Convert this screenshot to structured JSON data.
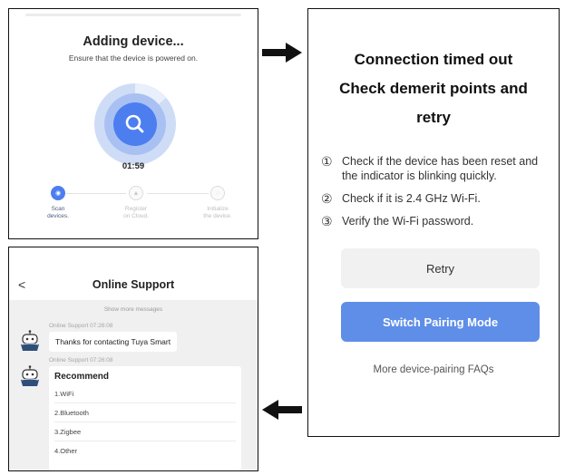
{
  "adding": {
    "title": "Adding device...",
    "subtitle": "Ensure that the device is powered on.",
    "timer": "01:59",
    "icon": "search-icon",
    "accent_color": "#4c7ef0",
    "steps": [
      {
        "label": "Scan\ndevices."
      },
      {
        "label": "Register\non Cloud."
      },
      {
        "label": "Initialize\nthe device."
      }
    ]
  },
  "timeout": {
    "title": "Connection timed out\nCheck demerit points and\nretry",
    "checks": [
      {
        "num": "①",
        "text": "Check if the device has been reset and the indicator is blinking quickly."
      },
      {
        "num": "②",
        "text": "Check if it is 2.4 GHz Wi-Fi."
      },
      {
        "num": "③",
        "text": "Verify the Wi-Fi password."
      }
    ],
    "retry_label": "Retry",
    "switch_label": "Switch Pairing Mode",
    "faq_label": "More device-pairing FAQs",
    "button_color": "#5f8ee8"
  },
  "support": {
    "back_label": "<",
    "title": "Online Support",
    "show_more": "Show more messages",
    "messages": [
      {
        "meta": "Online Support  07:26:08",
        "text": "Thanks for contacting Tuya Smart"
      },
      {
        "meta": "Online Support  07:26:08"
      }
    ],
    "recommend": {
      "title": "Recommend",
      "options": [
        "1.WiFi",
        "2.Bluetooth",
        "3.Zigbee",
        "4.Other"
      ]
    }
  }
}
